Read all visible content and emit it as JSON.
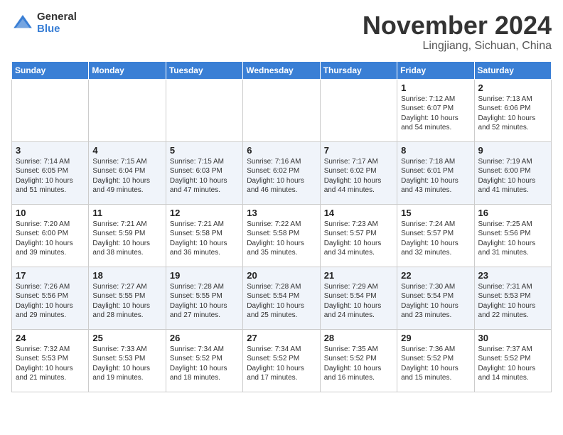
{
  "logo": {
    "general": "General",
    "blue": "Blue"
  },
  "header": {
    "month": "November 2024",
    "location": "Lingjiang, Sichuan, China"
  },
  "weekdays": [
    "Sunday",
    "Monday",
    "Tuesday",
    "Wednesday",
    "Thursday",
    "Friday",
    "Saturday"
  ],
  "weeks": [
    [
      {
        "day": "",
        "info": ""
      },
      {
        "day": "",
        "info": ""
      },
      {
        "day": "",
        "info": ""
      },
      {
        "day": "",
        "info": ""
      },
      {
        "day": "",
        "info": ""
      },
      {
        "day": "1",
        "info": "Sunrise: 7:12 AM\nSunset: 6:07 PM\nDaylight: 10 hours\nand 54 minutes."
      },
      {
        "day": "2",
        "info": "Sunrise: 7:13 AM\nSunset: 6:06 PM\nDaylight: 10 hours\nand 52 minutes."
      }
    ],
    [
      {
        "day": "3",
        "info": "Sunrise: 7:14 AM\nSunset: 6:05 PM\nDaylight: 10 hours\nand 51 minutes."
      },
      {
        "day": "4",
        "info": "Sunrise: 7:15 AM\nSunset: 6:04 PM\nDaylight: 10 hours\nand 49 minutes."
      },
      {
        "day": "5",
        "info": "Sunrise: 7:15 AM\nSunset: 6:03 PM\nDaylight: 10 hours\nand 47 minutes."
      },
      {
        "day": "6",
        "info": "Sunrise: 7:16 AM\nSunset: 6:02 PM\nDaylight: 10 hours\nand 46 minutes."
      },
      {
        "day": "7",
        "info": "Sunrise: 7:17 AM\nSunset: 6:02 PM\nDaylight: 10 hours\nand 44 minutes."
      },
      {
        "day": "8",
        "info": "Sunrise: 7:18 AM\nSunset: 6:01 PM\nDaylight: 10 hours\nand 43 minutes."
      },
      {
        "day": "9",
        "info": "Sunrise: 7:19 AM\nSunset: 6:00 PM\nDaylight: 10 hours\nand 41 minutes."
      }
    ],
    [
      {
        "day": "10",
        "info": "Sunrise: 7:20 AM\nSunset: 6:00 PM\nDaylight: 10 hours\nand 39 minutes."
      },
      {
        "day": "11",
        "info": "Sunrise: 7:21 AM\nSunset: 5:59 PM\nDaylight: 10 hours\nand 38 minutes."
      },
      {
        "day": "12",
        "info": "Sunrise: 7:21 AM\nSunset: 5:58 PM\nDaylight: 10 hours\nand 36 minutes."
      },
      {
        "day": "13",
        "info": "Sunrise: 7:22 AM\nSunset: 5:58 PM\nDaylight: 10 hours\nand 35 minutes."
      },
      {
        "day": "14",
        "info": "Sunrise: 7:23 AM\nSunset: 5:57 PM\nDaylight: 10 hours\nand 34 minutes."
      },
      {
        "day": "15",
        "info": "Sunrise: 7:24 AM\nSunset: 5:57 PM\nDaylight: 10 hours\nand 32 minutes."
      },
      {
        "day": "16",
        "info": "Sunrise: 7:25 AM\nSunset: 5:56 PM\nDaylight: 10 hours\nand 31 minutes."
      }
    ],
    [
      {
        "day": "17",
        "info": "Sunrise: 7:26 AM\nSunset: 5:56 PM\nDaylight: 10 hours\nand 29 minutes."
      },
      {
        "day": "18",
        "info": "Sunrise: 7:27 AM\nSunset: 5:55 PM\nDaylight: 10 hours\nand 28 minutes."
      },
      {
        "day": "19",
        "info": "Sunrise: 7:28 AM\nSunset: 5:55 PM\nDaylight: 10 hours\nand 27 minutes."
      },
      {
        "day": "20",
        "info": "Sunrise: 7:28 AM\nSunset: 5:54 PM\nDaylight: 10 hours\nand 25 minutes."
      },
      {
        "day": "21",
        "info": "Sunrise: 7:29 AM\nSunset: 5:54 PM\nDaylight: 10 hours\nand 24 minutes."
      },
      {
        "day": "22",
        "info": "Sunrise: 7:30 AM\nSunset: 5:54 PM\nDaylight: 10 hours\nand 23 minutes."
      },
      {
        "day": "23",
        "info": "Sunrise: 7:31 AM\nSunset: 5:53 PM\nDaylight: 10 hours\nand 22 minutes."
      }
    ],
    [
      {
        "day": "24",
        "info": "Sunrise: 7:32 AM\nSunset: 5:53 PM\nDaylight: 10 hours\nand 21 minutes."
      },
      {
        "day": "25",
        "info": "Sunrise: 7:33 AM\nSunset: 5:53 PM\nDaylight: 10 hours\nand 19 minutes."
      },
      {
        "day": "26",
        "info": "Sunrise: 7:34 AM\nSunset: 5:52 PM\nDaylight: 10 hours\nand 18 minutes."
      },
      {
        "day": "27",
        "info": "Sunrise: 7:34 AM\nSunset: 5:52 PM\nDaylight: 10 hours\nand 17 minutes."
      },
      {
        "day": "28",
        "info": "Sunrise: 7:35 AM\nSunset: 5:52 PM\nDaylight: 10 hours\nand 16 minutes."
      },
      {
        "day": "29",
        "info": "Sunrise: 7:36 AM\nSunset: 5:52 PM\nDaylight: 10 hours\nand 15 minutes."
      },
      {
        "day": "30",
        "info": "Sunrise: 7:37 AM\nSunset: 5:52 PM\nDaylight: 10 hours\nand 14 minutes."
      }
    ]
  ]
}
